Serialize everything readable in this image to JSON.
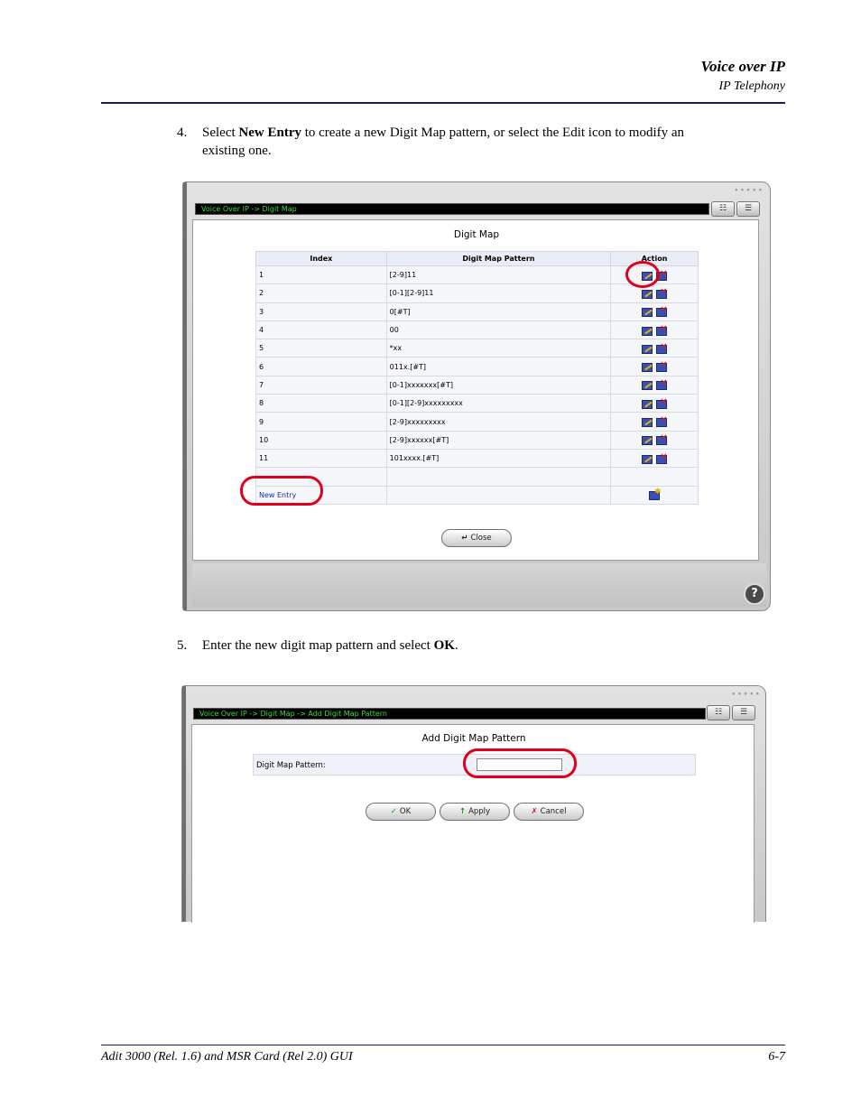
{
  "header": {
    "title": "Voice over IP",
    "subtitle": "IP Telephony"
  },
  "steps": [
    {
      "num": "4.",
      "pre": "Select ",
      "bold": "New Entry",
      "post": " to create a new Digit Map pattern, or select the Edit icon to modify an",
      "line2": "existing one."
    },
    {
      "num": "5.",
      "pre": "Enter the new digit map pattern and select ",
      "bold": "OK",
      "post": "."
    }
  ],
  "screen1": {
    "path": "Voice Over IP -> Digit Map",
    "title": "Digit Map",
    "columns": [
      "Index",
      "Digit Map Pattern",
      "Action"
    ],
    "rows": [
      {
        "index": "1",
        "pattern": "[2-9]11"
      },
      {
        "index": "2",
        "pattern": "[0-1][2-9]11"
      },
      {
        "index": "3",
        "pattern": "0[#T]"
      },
      {
        "index": "4",
        "pattern": "00"
      },
      {
        "index": "5",
        "pattern": "*xx"
      },
      {
        "index": "6",
        "pattern": "011x.[#T]"
      },
      {
        "index": "7",
        "pattern": "[0-1]xxxxxxx[#T]"
      },
      {
        "index": "8",
        "pattern": "[0-1][2-9]xxxxxxxxx"
      },
      {
        "index": "9",
        "pattern": "[2-9]xxxxxxxxx"
      },
      {
        "index": "10",
        "pattern": "[2-9]xxxxxx[#T]"
      },
      {
        "index": "11",
        "pattern": "101xxxx.[#T]"
      }
    ],
    "new_entry": "New Entry",
    "close": "Close",
    "help": "?"
  },
  "screen2": {
    "path": "Voice Over IP -> Digit Map -> Add Digit Map Pattern",
    "title": "Add Digit Map Pattern",
    "field_label": "Digit Map Pattern:",
    "field_value": "",
    "ok": "OK",
    "apply": "Apply",
    "cancel": "Cancel"
  },
  "footer": {
    "left": "Adit 3000 (Rel. 1.6) and MSR Card (Rel 2.0) GUI",
    "right": "6-7"
  },
  "colors": {
    "path_text": "#3ddc3d",
    "highlight_ring": "#e0001b",
    "rule": "#1a1a5e"
  }
}
